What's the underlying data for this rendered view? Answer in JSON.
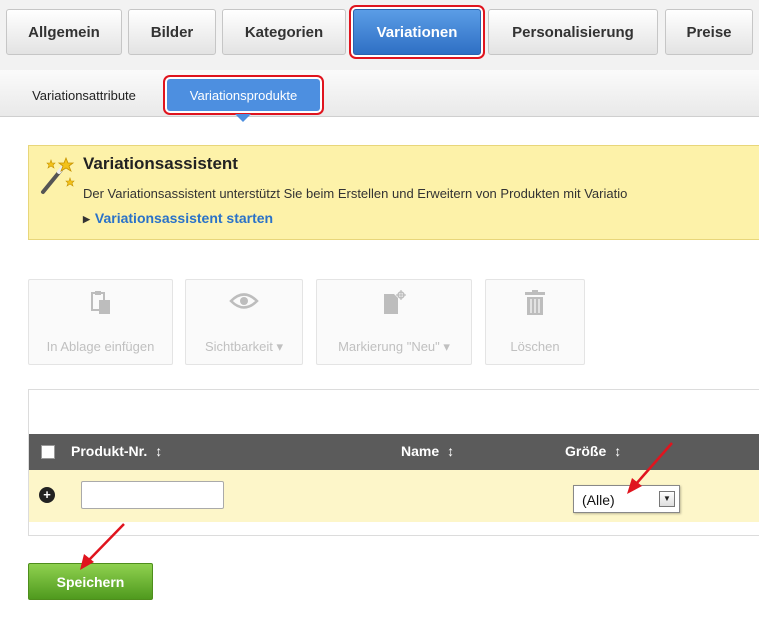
{
  "top_tabs": [
    {
      "label": "Allgemein"
    },
    {
      "label": "Bilder"
    },
    {
      "label": "Kategorien"
    },
    {
      "label": "Variationen"
    },
    {
      "label": "Personalisierung"
    },
    {
      "label": "Preise"
    }
  ],
  "active_top_tab": "Variationen",
  "sub_tabs": [
    {
      "label": "Variationsattribute"
    },
    {
      "label": "Variationsprodukte"
    }
  ],
  "active_sub_tab": "Variationsprodukte",
  "assistant": {
    "title": "Variationsassistent",
    "text": "Der Variationsassistent unterstützt Sie beim Erstellen und Erweitern von Produkten mit Variatio",
    "link": "Variationsassistent starten",
    "icon": "magic-wand-icon"
  },
  "toolbar": [
    {
      "label": "In Ablage einfügen",
      "icon": "clipboard-icon"
    },
    {
      "label": "Sichtbarkeit ▾",
      "icon": "eye-icon"
    },
    {
      "label": "Markierung \"Neu\" ▾",
      "icon": "new-document-icon"
    },
    {
      "label": "Löschen",
      "icon": "trash-icon"
    }
  ],
  "table": {
    "columns": [
      {
        "label": "Produkt-Nr."
      },
      {
        "label": "Name"
      },
      {
        "label": "Größe"
      }
    ],
    "filter_row": {
      "product_no_value": "",
      "size_value": "(Alle)"
    }
  },
  "save_label": "Speichern",
  "colors": {
    "active_tab": "#3a7fd6",
    "highlight": "#e0141e",
    "assistant_bg": "#fdf2a9",
    "link": "#2a72c8",
    "table_header": "#5b5b5b",
    "save": "#6cb52f"
  }
}
